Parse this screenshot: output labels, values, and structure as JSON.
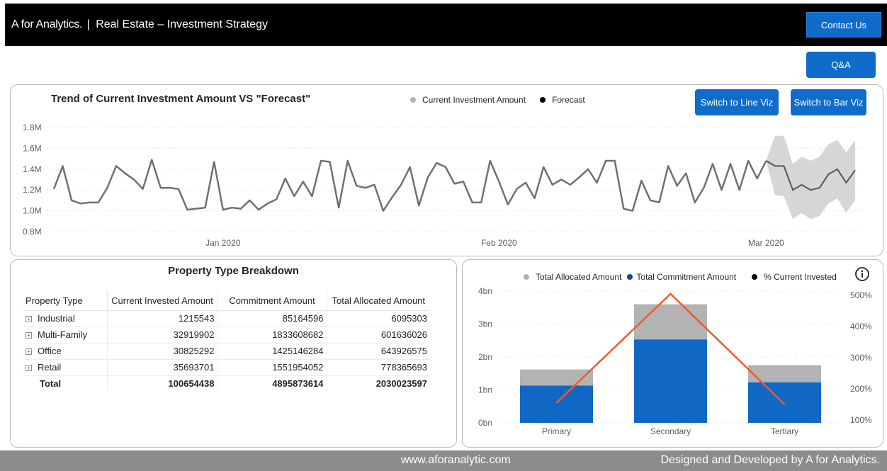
{
  "header": {
    "brand": "A for Analytics.",
    "separator": "|",
    "title": "Real Estate – Investment Strategy",
    "contact_label": "Contact Us"
  },
  "qa_label": "Q&A",
  "trend": {
    "title": "Trend of Current Investment Amount VS \"Forecast\"",
    "legend": [
      {
        "label": "Current Investment Amount",
        "color": "#b3b3b3"
      },
      {
        "label": "Forecast",
        "color": "#000000"
      }
    ],
    "switch_line_label": "Switch to Line Viz",
    "switch_bar_label": "Switch to Bar Viz"
  },
  "table": {
    "title": "Property Type Breakdown",
    "columns": [
      "Property Type",
      "Current Invested Amount",
      "Commitment Amount",
      "Total Allocated Amount"
    ],
    "rows": [
      [
        "Industrial",
        "1215543",
        "85164596",
        "6095303"
      ],
      [
        "Multi-Family",
        "32919902",
        "1833608682",
        "601636026"
      ],
      [
        "Office",
        "30825292",
        "1425146284",
        "643926575"
      ],
      [
        "Retail",
        "35693701",
        "1551954052",
        "778365693"
      ]
    ],
    "total": [
      "Total",
      "100654438",
      "4895873614",
      "2030023597"
    ]
  },
  "bar_legend": [
    {
      "label": "Total Allocated Amount",
      "color": "#b3b3b3"
    },
    {
      "label": "Total Commitment Amount",
      "color": "#1540b0"
    },
    {
      "label": "% Current Invested",
      "color": "#000000"
    }
  ],
  "footer": {
    "url": "www.aforanalytic.com",
    "credit": "Designed and Developed by A for Analytics."
  },
  "colors": {
    "accent_blue": "#0f6cc9",
    "bar_blue": "#1168c4",
    "bar_gray": "#b3b3b3",
    "line_gray": "#707070",
    "forecast_band": "#d6d6d6",
    "forecast_line": "#555555",
    "pct_line": "#f05a28",
    "footer_bg": "#8c8c8c"
  },
  "chart_data": [
    {
      "type": "line",
      "title": "Trend of Current Investment Amount VS \"Forecast\"",
      "y_ticks": [
        "1.8M",
        "1.6M",
        "1.4M",
        "1.2M",
        "1.0M",
        "0.8M"
      ],
      "ylim": [
        0.8,
        1.8
      ],
      "x_ticks": [
        {
          "label": "Jan 2020",
          "index": 19
        },
        {
          "label": "Feb 2020",
          "index": 50
        },
        {
          "label": "Mar 2020",
          "index": 80
        }
      ],
      "grid": true,
      "legend_position": "top-center",
      "series": [
        {
          "name": "Current Investment Amount",
          "unit": "M",
          "values": [
            1.21,
            1.43,
            1.1,
            1.07,
            1.08,
            1.08,
            1.22,
            1.43,
            1.36,
            1.3,
            1.21,
            1.49,
            1.22,
            1.22,
            1.21,
            1.01,
            1.02,
            1.03,
            1.47,
            1.01,
            1.03,
            1.02,
            1.1,
            1.01,
            1.07,
            1.11,
            1.31,
            1.14,
            1.28,
            1.14,
            1.48,
            1.47,
            1.03,
            1.48,
            1.24,
            1.22,
            1.25,
            1.0,
            1.13,
            1.25,
            1.42,
            1.05,
            1.32,
            1.46,
            1.42,
            1.26,
            1.28,
            1.08,
            1.08,
            1.48,
            1.28,
            1.06,
            1.21,
            1.27,
            1.12,
            1.42,
            1.25,
            1.3,
            1.25,
            1.32,
            1.4,
            1.27,
            1.48,
            1.48,
            1.02,
            1.0,
            1.29,
            1.1,
            1.08,
            1.43,
            1.24,
            1.36,
            1.08,
            1.22,
            1.45,
            1.2,
            1.45,
            1.2,
            1.48,
            1.31,
            1.48
          ]
        },
        {
          "name": "Forecast",
          "unit": "M",
          "start_index": 80,
          "values": [
            1.48,
            1.43,
            1.43,
            1.2,
            1.25,
            1.2,
            1.22,
            1.35,
            1.4,
            1.27,
            1.39
          ],
          "upper": [
            1.48,
            1.72,
            1.72,
            1.45,
            1.52,
            1.48,
            1.52,
            1.64,
            1.68,
            1.56,
            1.68
          ],
          "lower": [
            1.48,
            1.15,
            1.14,
            0.92,
            0.98,
            0.92,
            0.95,
            1.07,
            1.12,
            0.98,
            1.1
          ]
        }
      ]
    },
    {
      "type": "bar",
      "categories": [
        "Primary",
        "Secondary",
        "Tertiary"
      ],
      "ylim": [
        0,
        4
      ],
      "y_ticks": [
        "0bn",
        "1bn",
        "2bn",
        "3bn",
        "4bn"
      ],
      "y2_ticks": [
        "100%",
        "200%",
        "300%",
        "400%",
        "500%"
      ],
      "y2lim": [
        100,
        500
      ],
      "legend_position": "top",
      "series": [
        {
          "name": "Total Allocated Amount",
          "unit": "bn",
          "values": [
            1.62,
            3.6,
            1.75
          ]
        },
        {
          "name": "Total Commitment Amount",
          "unit": "bn",
          "values": [
            1.13,
            2.53,
            1.23
          ]
        },
        {
          "name": "% Current Invested",
          "unit": "%",
          "values": [
            155,
            505,
            150
          ],
          "axis": "secondary"
        }
      ]
    }
  ]
}
